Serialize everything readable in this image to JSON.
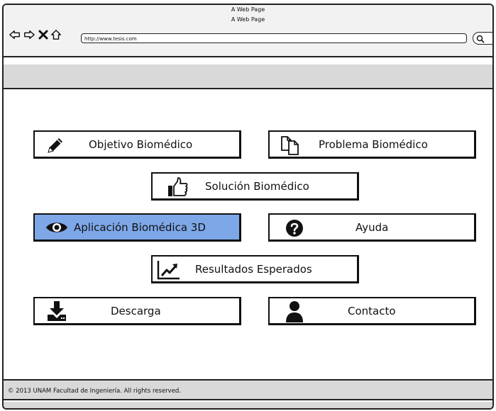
{
  "window": {
    "title": "A Web Page",
    "page_title": "A Web Page",
    "url": "http://www.tesis.com"
  },
  "nav_icons": [
    "back-arrow-icon",
    "forward-arrow-icon",
    "stop-icon",
    "home-icon",
    "search-icon"
  ],
  "menu": {
    "objetivo": {
      "label": "Objetivo Biomédico",
      "icon": "pencil-icon"
    },
    "problema": {
      "label": "Problema Biomédico",
      "icon": "copy-documents-icon"
    },
    "solucion": {
      "label": "Solución Biomédico",
      "icon": "thumbs-up-icon"
    },
    "aplicacion": {
      "label": "Aplicación Biomédica 3D",
      "icon": "eye-icon",
      "selected": true
    },
    "ayuda": {
      "label": "Ayuda",
      "icon": "question-circle-icon"
    },
    "resultados": {
      "label": "Resultados Esperados",
      "icon": "line-chart-icon"
    },
    "descarga": {
      "label": "Descarga",
      "icon": "download-icon"
    },
    "contacto": {
      "label": "Contacto",
      "icon": "user-icon"
    }
  },
  "footer": {
    "text": "© 2013 UNAM Facultad de Ingeniería. All rights reserved."
  },
  "colors": {
    "selected_button": "#7ea7e8",
    "bar_gray": "#d9d9d9"
  }
}
